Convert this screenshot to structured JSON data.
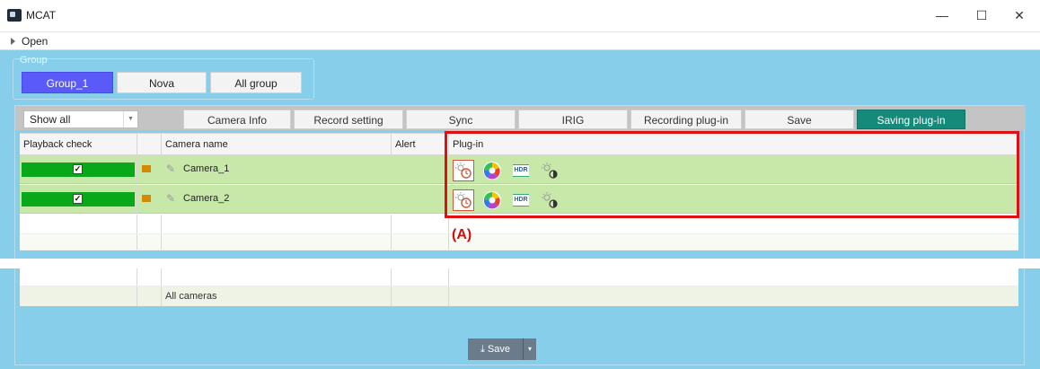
{
  "window": {
    "title": "MCAT",
    "minimize": "—",
    "maximize": "☐",
    "close": "✕"
  },
  "open_label": "Open",
  "group": {
    "label": "Group",
    "buttons": [
      "Group_1",
      "Nova",
      "All group"
    ],
    "active": "Group_1"
  },
  "toolbar": {
    "filter": "Show all",
    "tabs": [
      "Camera Info",
      "Record setting",
      "Sync",
      "IRIG",
      "Recording plug-in",
      "Save",
      "Saving plug-in"
    ],
    "active_tab": "Saving plug-in"
  },
  "grid": {
    "headers": [
      "Playback check",
      "",
      "Camera name",
      "Alert",
      "Plug-in"
    ],
    "rows": [
      {
        "checked": true,
        "camera_name": "Camera_1"
      },
      {
        "checked": true,
        "camera_name": "Camera_2"
      }
    ],
    "plugin_icons": [
      "time-lapse-icon",
      "color-wheel-icon",
      "hdr-icon",
      "brightness-contrast-icon"
    ],
    "all_cameras_label": "All cameras"
  },
  "annotation": "(A)",
  "save": {
    "label": "Save",
    "dropdown": "▾"
  },
  "colors": {
    "accent": "#5a5af8",
    "active_tab": "#168a7a",
    "row_green": "#c7e8a9",
    "bar_green": "#09a81b",
    "highlight_box": "#e01010",
    "background": "#87ceea"
  }
}
